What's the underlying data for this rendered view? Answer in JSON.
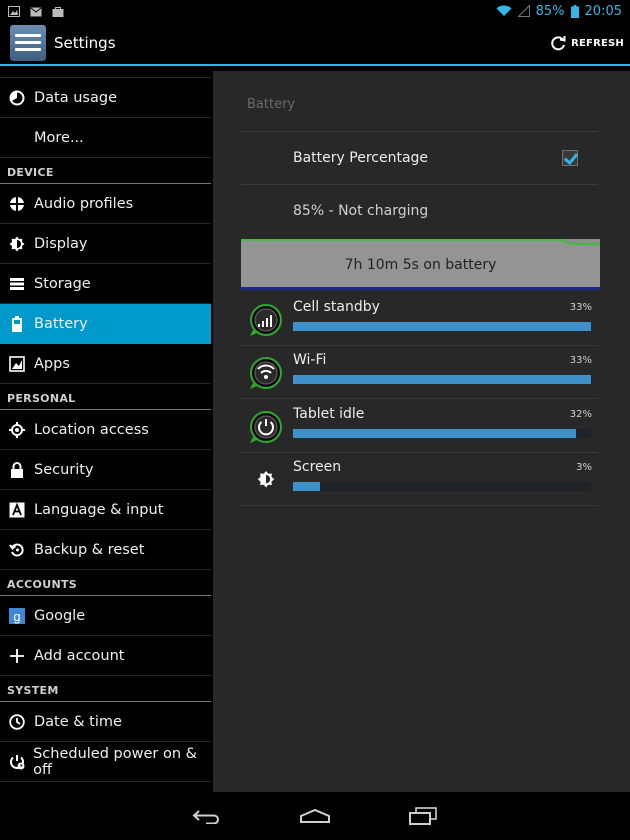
{
  "status": {
    "battery_percent": "85%",
    "time": "20:05"
  },
  "header": {
    "title": "Settings",
    "refresh_label": "REFRESH"
  },
  "sidebar": {
    "items": [
      {
        "label": "Data usage",
        "icon": "data-usage-icon"
      },
      {
        "label": "More..."
      },
      {
        "header": "DEVICE"
      },
      {
        "label": "Audio profiles",
        "icon": "audio-profiles-icon"
      },
      {
        "label": "Display",
        "icon": "display-brightness-icon"
      },
      {
        "label": "Storage",
        "icon": "storage-icon"
      },
      {
        "label": "Battery",
        "icon": "battery-icon",
        "active": true
      },
      {
        "label": "Apps",
        "icon": "apps-icon"
      },
      {
        "header": "PERSONAL"
      },
      {
        "label": "Location access",
        "icon": "location-icon"
      },
      {
        "label": "Security",
        "icon": "lock-icon"
      },
      {
        "label": "Language & input",
        "icon": "language-icon"
      },
      {
        "label": "Backup & reset",
        "icon": "backup-icon"
      },
      {
        "header": "ACCOUNTS"
      },
      {
        "label": "Google",
        "icon": "google-icon"
      },
      {
        "label": "Add account",
        "icon": "plus-icon"
      },
      {
        "header": "SYSTEM"
      },
      {
        "label": "Date & time",
        "icon": "clock-icon"
      },
      {
        "label": "Scheduled power on & off",
        "icon": "power-schedule-icon"
      }
    ]
  },
  "battery": {
    "section_title": "Battery",
    "percentage_label": "Battery Percentage",
    "percentage_checked": true,
    "status_text": "85% - Not charging",
    "graph_text": "7h 10m 5s on battery",
    "accent_color": "#33b5e5",
    "usage": [
      {
        "name": "Cell standby",
        "percent_label": "33%",
        "value": 33,
        "icon": "cell-standby-icon"
      },
      {
        "name": "Wi-Fi",
        "percent_label": "33%",
        "value": 33,
        "icon": "wifi-icon"
      },
      {
        "name": "Tablet idle",
        "percent_label": "32%",
        "value": 32,
        "icon": "tablet-idle-icon"
      },
      {
        "name": "Screen",
        "percent_label": "3%",
        "value": 3,
        "icon": "screen-brightness-icon"
      }
    ]
  }
}
